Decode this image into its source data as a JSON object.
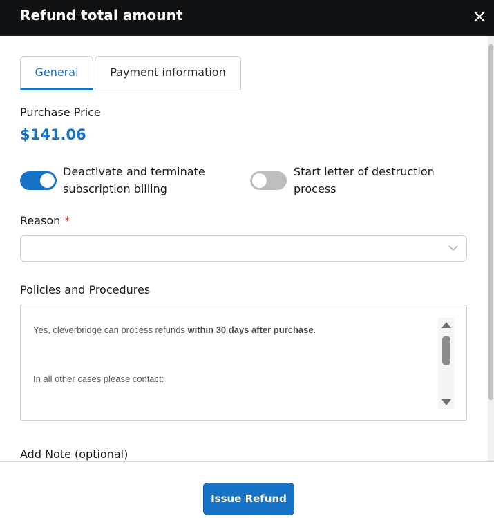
{
  "dialog": {
    "title": "Refund total amount",
    "close_icon": "close-icon"
  },
  "tabs": [
    {
      "label": "General",
      "active": true
    },
    {
      "label": "Payment information",
      "active": false
    }
  ],
  "purchase": {
    "label": "Purchase Price",
    "value": "$141.06"
  },
  "toggles": [
    {
      "line1": "Deactivate and terminate",
      "line2": "subscription billing",
      "checked": true
    },
    {
      "line1": "Start letter of destruction",
      "line2": "process",
      "checked": false
    }
  ],
  "reason": {
    "label": "Reason",
    "required_marker": "*",
    "value": "",
    "icon": "chevron-down-icon"
  },
  "policies": {
    "label": "Policies and Procedures",
    "line1_prefix": "Yes, cleverbridge can process refunds ",
    "line1_bold": "within 30 days after purchase",
    "line1_suffix": ".",
    "line2": "In all other cases please contact:"
  },
  "note": {
    "label": "Add Note (optional)"
  },
  "footer": {
    "submit_label": "Issue Refund"
  },
  "colors": {
    "accent": "#1673c8",
    "header_bg": "#101213",
    "required": "#d9352b"
  }
}
